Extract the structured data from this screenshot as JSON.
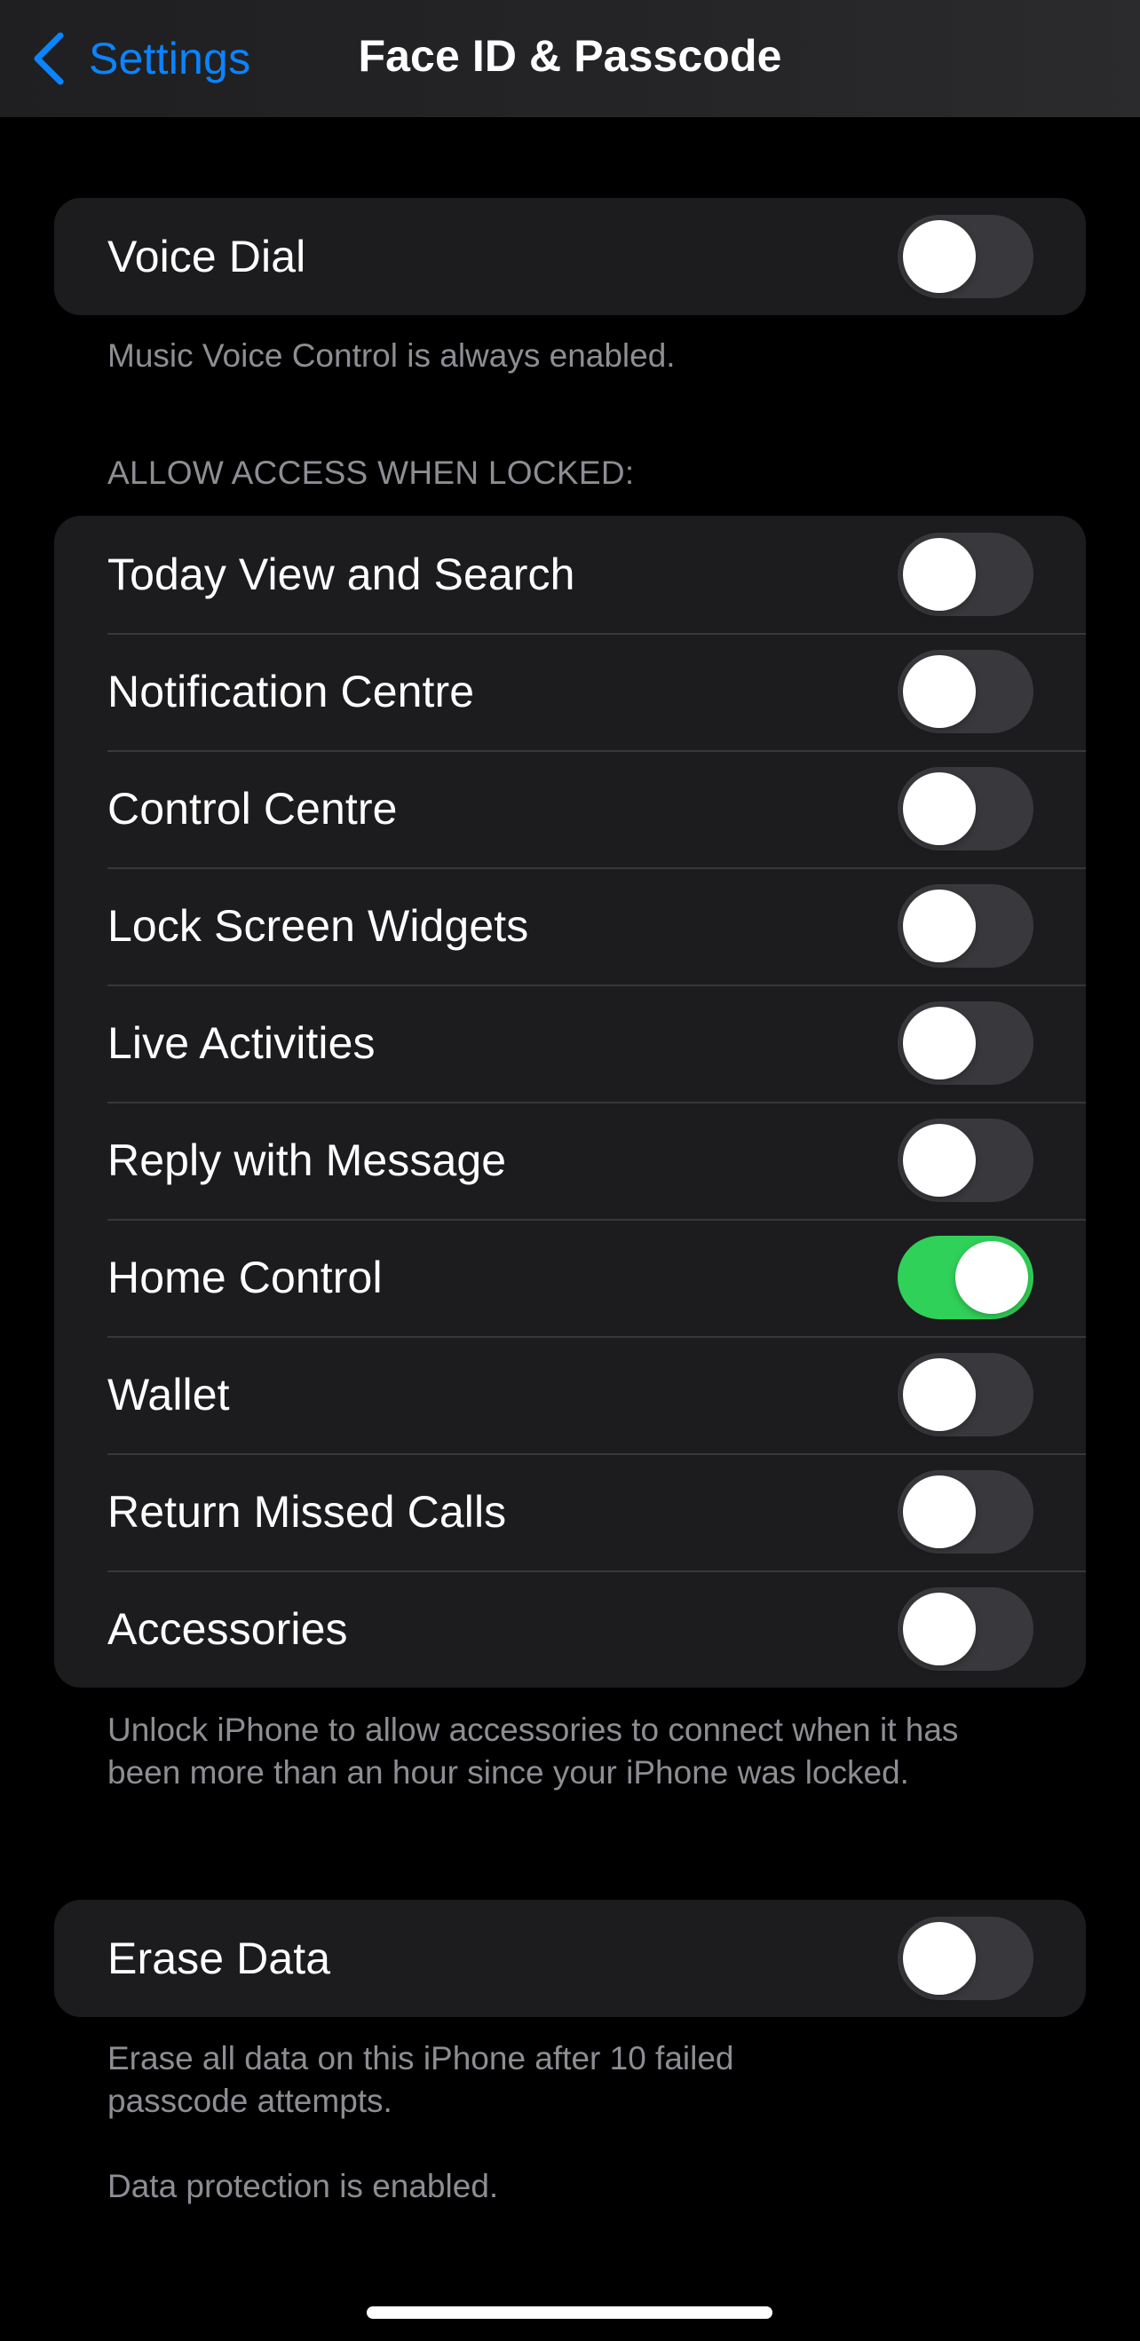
{
  "navbar": {
    "back_label": "Settings",
    "back_icon": "chevron-left-icon",
    "title": "Face ID & Passcode"
  },
  "colors": {
    "accent": "#0A84FF",
    "toggle_on": "#30D158",
    "toggle_off": "#39393D",
    "cell_background": "#1C1C1E",
    "secondary_text": "#8D8D93"
  },
  "voice_section": {
    "rows": [
      {
        "label": "Voice Dial",
        "enabled": false
      }
    ],
    "footer": "Music Voice Control is always enabled."
  },
  "locked_section": {
    "header": "ALLOW ACCESS WHEN LOCKED:",
    "rows": [
      {
        "label": "Today View and Search",
        "enabled": false
      },
      {
        "label": "Notification Centre",
        "enabled": false
      },
      {
        "label": "Control Centre",
        "enabled": false
      },
      {
        "label": "Lock Screen Widgets",
        "enabled": false
      },
      {
        "label": "Live Activities",
        "enabled": false
      },
      {
        "label": "Reply with Message",
        "enabled": false
      },
      {
        "label": "Home Control",
        "enabled": true
      },
      {
        "label": "Wallet",
        "enabled": false
      },
      {
        "label": "Return Missed Calls",
        "enabled": false
      },
      {
        "label": "Accessories",
        "enabled": false
      }
    ],
    "footer": "Unlock iPhone to allow accessories to connect when it has been more than an hour since your iPhone was locked."
  },
  "erase_section": {
    "rows": [
      {
        "label": "Erase Data",
        "enabled": false
      }
    ],
    "footer": "Erase all data on this iPhone after 10 failed passcode attempts.",
    "footer_note": "Data protection is enabled."
  }
}
